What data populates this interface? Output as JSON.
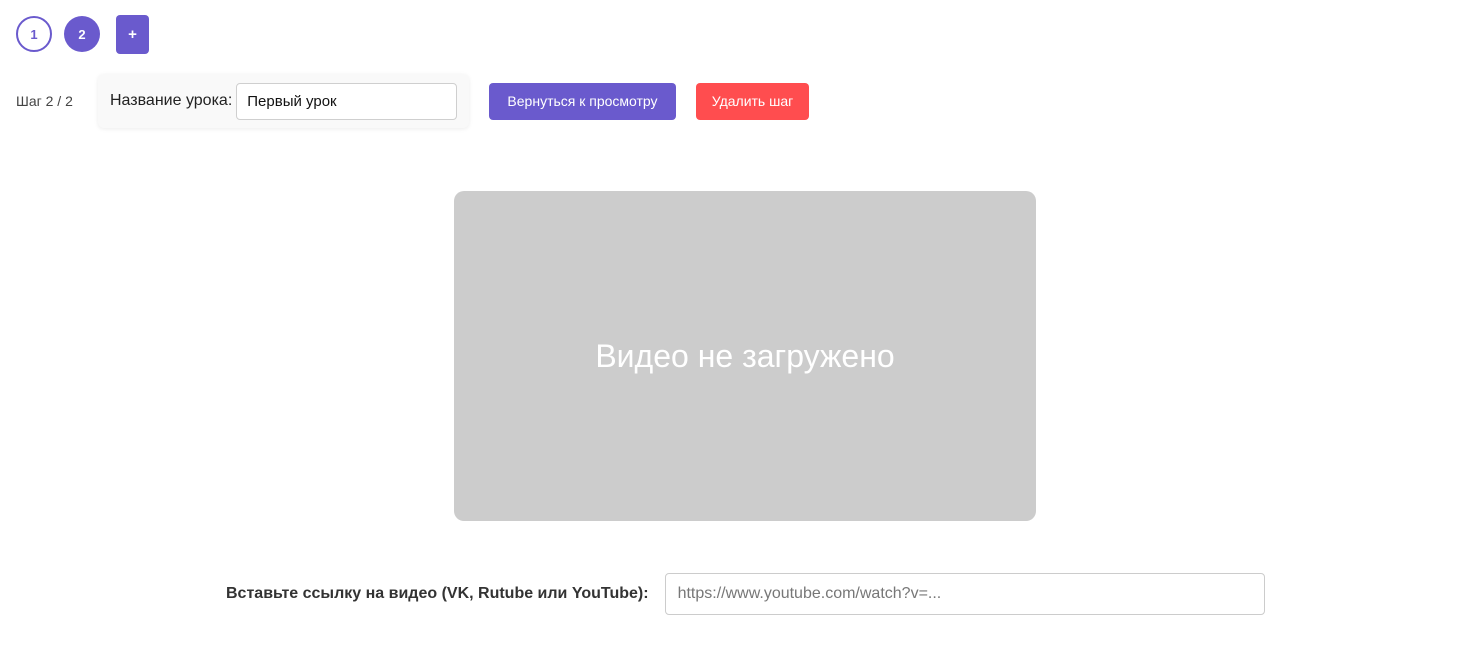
{
  "steps": [
    {
      "label": "1",
      "active": false
    },
    {
      "label": "2",
      "active": true
    }
  ],
  "add_step_label": "+",
  "step_counter": "Шаг 2 / 2",
  "lesson_title": {
    "label": "Название урока:",
    "value": "Первый урок"
  },
  "buttons": {
    "back_label": "Вернуться к просмотру",
    "delete_label": "Удалить шаг"
  },
  "video": {
    "placeholder_text": "Видео не загружено"
  },
  "video_url": {
    "label": "Вставьте ссылку на видео (VK, Rutube или YouTube):",
    "placeholder": "https://www.youtube.com/watch?v=...",
    "value": ""
  },
  "colors": {
    "accent": "#6a5acd",
    "danger": "#ff4d4f",
    "video_bg": "#cccccc"
  }
}
